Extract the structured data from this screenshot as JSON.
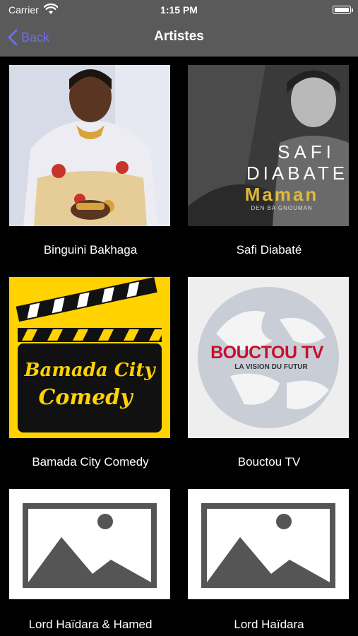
{
  "status_bar": {
    "carrier": "Carrier",
    "time": "1:15 PM"
  },
  "nav": {
    "back_label": "Back",
    "title": "Artistes"
  },
  "artists": [
    {
      "name": "Binguini Bakhaga"
    },
    {
      "name": "Safi Diabaté",
      "cover_text": {
        "line1": "SAFI",
        "line2": "DIABATE",
        "line3": "Maman",
        "line4": "DEN BA GNOUMAN"
      }
    },
    {
      "name": "Bamada City Comedy",
      "logo_text": {
        "line1": "Bamada City",
        "line2": "Comedy"
      }
    },
    {
      "name": "Bouctou TV",
      "logo_text": {
        "line1": "BOUCTOU TV",
        "line2": "LA VISION DU FUTUR"
      }
    },
    {
      "name": "Lord Haïdara & Hamed"
    },
    {
      "name": "Lord Haïdara"
    }
  ],
  "colors": {
    "accent": "#6e6ef0",
    "bar": "#5a5a5a",
    "background": "#000000",
    "comedy_yellow": "#ffd200",
    "bouctou_red": "#c8102e"
  }
}
